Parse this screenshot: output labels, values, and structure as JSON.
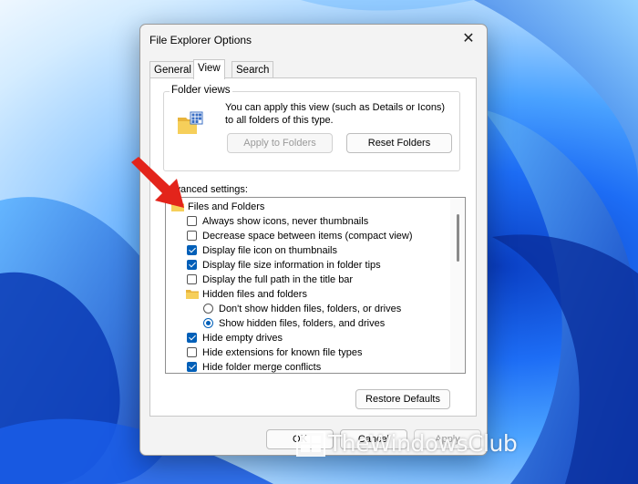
{
  "dialog": {
    "title": "File Explorer Options",
    "close_glyph": "✕",
    "tabs": [
      {
        "label": "General",
        "active": false
      },
      {
        "label": "View",
        "active": true
      },
      {
        "label": "Search",
        "active": false
      }
    ]
  },
  "folder_views": {
    "group_label": "Folder views",
    "description": "You can apply this view (such as Details or Icons) to all folders of this type.",
    "apply_button": "Apply to Folders",
    "reset_button": "Reset Folders"
  },
  "advanced": {
    "label": "Advanced settings:",
    "items": [
      {
        "type": "folder",
        "indent": 0,
        "label": "Files and Folders"
      },
      {
        "type": "checkbox",
        "indent": 1,
        "label": "Always show icons, never thumbnails",
        "checked": false
      },
      {
        "type": "checkbox",
        "indent": 1,
        "label": "Decrease space between items (compact view)",
        "checked": false
      },
      {
        "type": "checkbox",
        "indent": 1,
        "label": "Display file icon on thumbnails",
        "checked": true
      },
      {
        "type": "checkbox",
        "indent": 1,
        "label": "Display file size information in folder tips",
        "checked": true
      },
      {
        "type": "checkbox",
        "indent": 1,
        "label": "Display the full path in the title bar",
        "checked": false
      },
      {
        "type": "folder",
        "indent": 1,
        "label": "Hidden files and folders"
      },
      {
        "type": "radio",
        "indent": 2,
        "label": "Don't show hidden files, folders, or drives",
        "checked": false
      },
      {
        "type": "radio",
        "indent": 2,
        "label": "Show hidden files, folders, and drives",
        "checked": true
      },
      {
        "type": "checkbox",
        "indent": 1,
        "label": "Hide empty drives",
        "checked": true
      },
      {
        "type": "checkbox",
        "indent": 1,
        "label": "Hide extensions for known file types",
        "checked": false
      },
      {
        "type": "checkbox",
        "indent": 1,
        "label": "Hide folder merge conflicts",
        "checked": true
      }
    ]
  },
  "buttons": {
    "restore_defaults": "Restore Defaults",
    "ok": "OK",
    "cancel": "Cancel",
    "apply": "Apply"
  },
  "watermark": {
    "text": "TheWindowsClub"
  },
  "colors": {
    "accent": "#005fb8",
    "arrow": "#e3241b"
  }
}
